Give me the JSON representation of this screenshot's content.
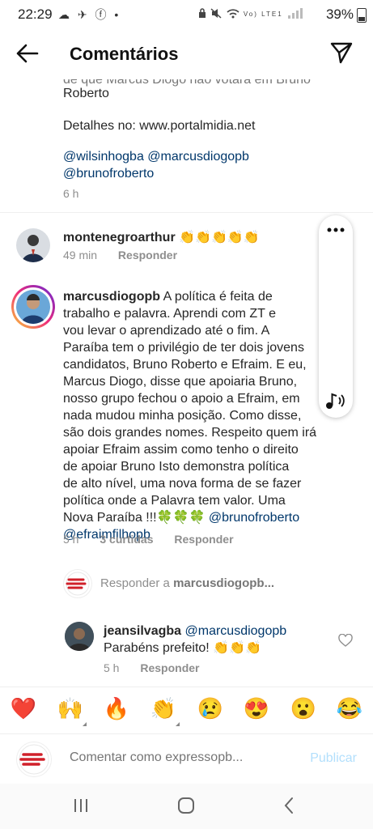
{
  "status_bar": {
    "time": "22:29",
    "notif_icons": "☁ ✈ ⓕ •",
    "network_label": "Vo) LTE1",
    "battery": "39%"
  },
  "header": {
    "title": "Comentários"
  },
  "top_comment": {
    "partial_line": "de que Marcus Diogo não votará em Bruno",
    "line2": "Roberto",
    "details": "Detalhes no: www.portalmidia.net",
    "mentions_line1": "@wilsinhogba @marcusdiogopb",
    "mentions_line2": "@brunofroberto",
    "time": "6 h"
  },
  "comment1": {
    "username": "montenegroarthur",
    "emojis": "👏👏👏👏👏",
    "time": "49 min",
    "reply": "Responder"
  },
  "comment2": {
    "username": "marcusdiogopb",
    "lines": [
      "A política é feita de",
      "trabalho e palavra. Aprendi com ZT e",
      "vou levar o aprendizado até o fim. A",
      "Paraíba tem o privilégio de ter dois jovens",
      "candidatos, Bruno Roberto e Efraim. E eu,",
      "Marcus Diogo, disse que apoiaria Bruno,",
      "nosso grupo fechou o apoio a Efraim, em",
      "nada mudou minha posição. Como disse,",
      "são dois grandes nomes. Respeito quem irá",
      "apoiar Efraim assim como tenho o direito",
      "de apoiar Bruno Isto demonstra política",
      "de alto nível, uma nova forma de se fazer",
      "política onde a Palavra tem valor. Uma",
      "Nova Paraíba !!!🍀🍀🍀"
    ],
    "mention1": "@brunofroberto",
    "mention2": "@efraimfilhopb",
    "time": "5 h",
    "likes": "3 curtidas",
    "reply": "Responder"
  },
  "reply_prompt": {
    "prefix": "Responder a ",
    "target": "marcusdiogopb..."
  },
  "comment3": {
    "username": "jeansilvagba",
    "mention": "@marcusdiogopb",
    "text": "Parabéns prefeito! 👏👏👏",
    "time": "5 h",
    "reply": "Responder"
  },
  "emoji_bar": [
    "❤️",
    "🙌",
    "🔥",
    "👏",
    "😢",
    "😍",
    "😮",
    "😂"
  ],
  "comment_input": {
    "placeholder": "Comentar como expressopb..."
  },
  "publish_label": "Publicar",
  "colors": {
    "link": "#00376b",
    "meta": "#8e8e8e",
    "publish_disabled": "#b2dffc"
  }
}
